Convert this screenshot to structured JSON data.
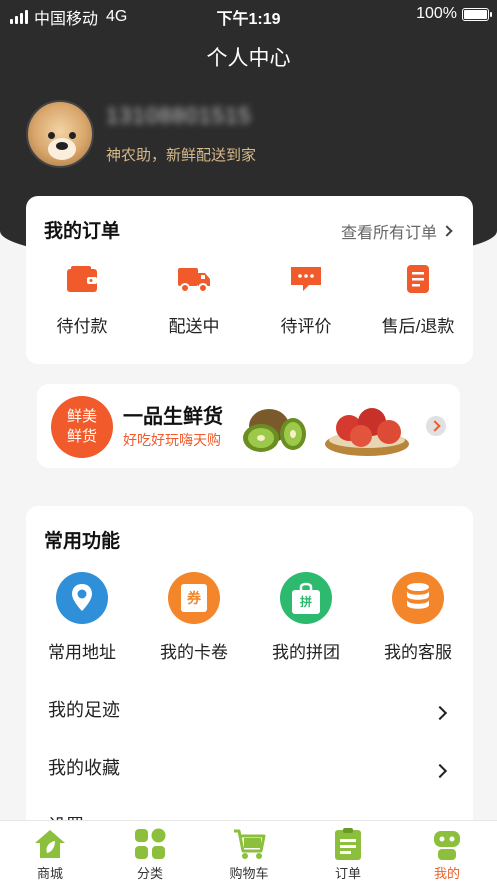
{
  "status_bar": {
    "carrier": "中国移动",
    "network": "4G",
    "time": "下午1:19",
    "battery": "100%",
    "battery_level": 1.0
  },
  "header": {
    "title": "个人中心"
  },
  "profile": {
    "phone": "13108801515",
    "slogan": "神农助，新鲜配送到家"
  },
  "orders": {
    "title": "我的订单",
    "view_all": "查看所有订单",
    "items": [
      {
        "label": "待付款",
        "icon": "wallet-icon"
      },
      {
        "label": "配送中",
        "icon": "delivery-truck-icon"
      },
      {
        "label": "待评价",
        "icon": "comment-icon"
      },
      {
        "label": "售后/退款",
        "icon": "document-icon"
      }
    ]
  },
  "banner": {
    "badge": "鲜美\n鲜货",
    "title": "一品生鲜货",
    "subtitle": "好吃好玩嗨天购"
  },
  "functions": {
    "title": "常用功能",
    "items": [
      {
        "label": "常用地址",
        "icon": "location-pin-icon",
        "color": "#2f8fd8"
      },
      {
        "label": "我的卡卷",
        "icon": "coupon-icon",
        "color": "#f3862a",
        "glyph": "券"
      },
      {
        "label": "我的拼团",
        "icon": "shopping-bag-icon",
        "color": "#2dba6e",
        "glyph": "拼"
      },
      {
        "label": "我的客服",
        "icon": "database-icon",
        "color": "#f3862a"
      }
    ],
    "list": [
      {
        "label": "我的足迹"
      },
      {
        "label": "我的收藏"
      },
      {
        "label": "设置"
      }
    ]
  },
  "tabbar": {
    "items": [
      {
        "label": "商城",
        "icon": "home-icon",
        "active": false
      },
      {
        "label": "分类",
        "icon": "grid-icon",
        "active": false
      },
      {
        "label": "购物车",
        "icon": "cart-icon",
        "active": false
      },
      {
        "label": "订单",
        "icon": "clipboard-icon",
        "active": false
      },
      {
        "label": "我的",
        "icon": "robot-icon",
        "active": true
      }
    ]
  },
  "colors": {
    "accent": "#f15a2a",
    "tab_green": "#8bbf3c",
    "header_dark": "#2c2c2c"
  }
}
